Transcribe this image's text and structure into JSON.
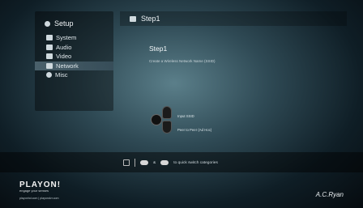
{
  "sidebar": {
    "title": "Setup",
    "items": [
      {
        "label": "System",
        "icon": "monitor-icon"
      },
      {
        "label": "Audio",
        "icon": "audio-icon"
      },
      {
        "label": "Video",
        "icon": "video-icon"
      },
      {
        "label": "Network",
        "icon": "network-icon",
        "active": true
      },
      {
        "label": "Misc",
        "icon": "info-icon"
      }
    ]
  },
  "main": {
    "header": "Step1",
    "step_title": "Step1",
    "description": "Create a Wireless Network Name (SSID)"
  },
  "options": {
    "input_ssid": "Input SSID",
    "peer_to_peer": "Peer to Peer (Ad Hoc)"
  },
  "bottom_hint": {
    "text": "to quick switch categories",
    "ampersand": "&"
  },
  "brand": {
    "name": "PLAYON!",
    "tagline": "engage your senses",
    "urls": "playonhd.com | playondvr.com",
    "vendor": "A.C.Ryan"
  }
}
